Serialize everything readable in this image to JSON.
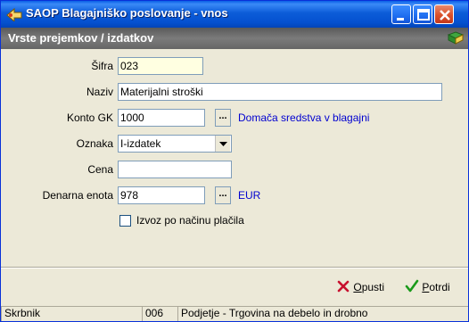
{
  "window": {
    "title": "SAOP Blagajniško poslovanje - vnos"
  },
  "header": {
    "title": "Vrste prejemkov / izdatkov"
  },
  "form": {
    "sifra": {
      "label": "Šifra",
      "value": "023"
    },
    "naziv": {
      "label": "Naziv",
      "value": "Materijalni stroški"
    },
    "konto_gk": {
      "label": "Konto GK",
      "value": "1000",
      "ellipsis": "...",
      "description": "Domača sredstva v blagajni"
    },
    "oznaka": {
      "label": "Oznaka",
      "value": "I-izdatek"
    },
    "cena": {
      "label": "Cena",
      "value": ""
    },
    "denarna_enota": {
      "label": "Denarna enota",
      "value": "978",
      "ellipsis": "...",
      "description": "EUR"
    },
    "izvoz": {
      "label": "Izvoz po načinu plačila",
      "checked": false
    }
  },
  "buttons": {
    "opusti_hotkey": "O",
    "opusti_rest": "pusti",
    "potrdi_hotkey": "P",
    "potrdi_rest": "otrdi"
  },
  "statusbar": {
    "user": "Skrbnik",
    "company_code": "006",
    "company_name": "Podjetje - Trgovina na debelo in drobno"
  },
  "colors": {
    "titlebar": "#0c5cd8",
    "header_band": "#6e6e6e",
    "link": "#0000d0",
    "required_field": "#ffffe1",
    "cancel_icon": "#c8102e",
    "confirm_icon": "#1a9a1a"
  }
}
